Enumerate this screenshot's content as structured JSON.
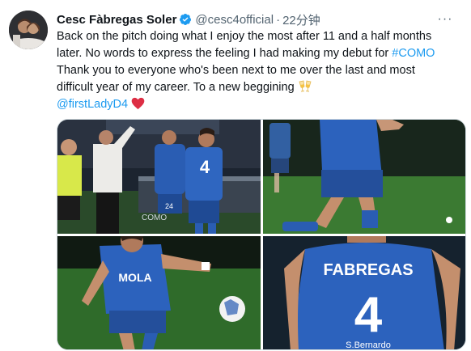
{
  "tweet": {
    "author_name": "Cesc Fàbregas Soler",
    "handle": "@cesc4official",
    "separator": "·",
    "time": "22分钟",
    "more_label": "···",
    "text_lines": [
      "Back on the pitch doing what I enjoy the most after 11 and a half months",
      "later. No words to express the feeling I had making my debut for "
    ],
    "hashtag": "#COMO",
    "text_lines_2": [
      "Thank you to everyone who's been next to me over the last and most",
      "difficult year of my career. To a new beggining "
    ],
    "mention": "@firstLadyD4",
    "emoji_1": "clinking-glasses-icon",
    "emoji_2": "red-heart-icon"
  },
  "media": {
    "images": [
      {
        "description": "Fabregas substitution at sideline",
        "jersey": "4",
        "bench_number": "24",
        "board_text": "COMO"
      },
      {
        "description": "Player kicking ball, blue kit"
      },
      {
        "description": "Fabregas passing ball",
        "shirt_text": "MOLA"
      },
      {
        "description": "Back of shirt",
        "shirt_name": "FABREGAS",
        "shirt_number": "4",
        "sponsor": "S.Bernardo"
      }
    ]
  },
  "colors": {
    "link": "#1d9bf0",
    "verified": "#1d9bf0",
    "secondary_text": "#536471",
    "kit_blue": "#2a5db3",
    "pitch_green": "#2f6b2a"
  }
}
